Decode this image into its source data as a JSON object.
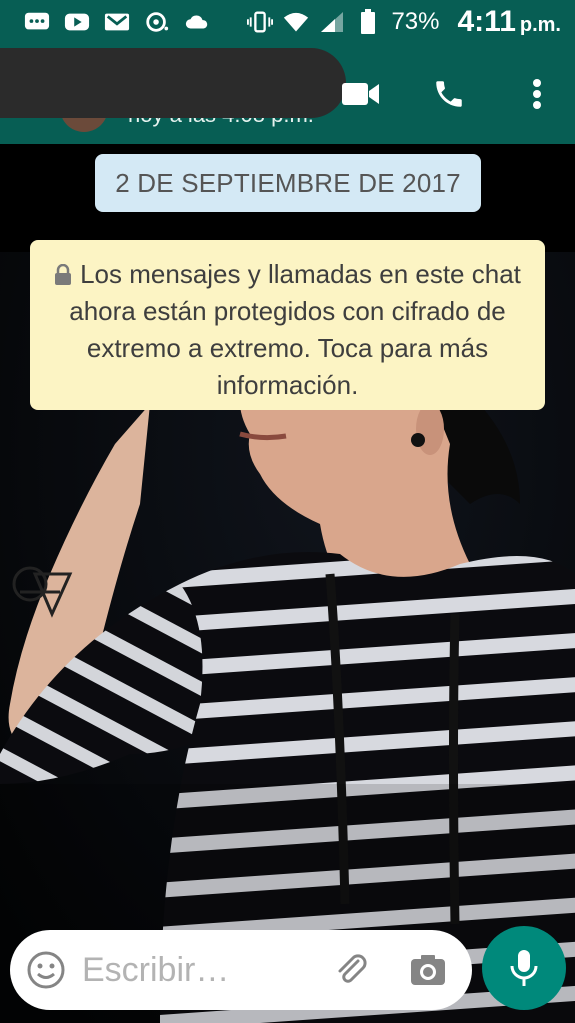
{
  "status_bar": {
    "battery_percent": "73%",
    "time": "4:11",
    "time_suffix": "p.m.",
    "icons": [
      "messages-icon",
      "youtube-icon",
      "gmail-icon",
      "chat-bubble-icon",
      "cloud-icon",
      "vibrate-icon",
      "wifi-icon",
      "signal-icon",
      "battery-icon"
    ]
  },
  "app_bar": {
    "last_seen": "hoy a las 4:08 p.m.",
    "actions": [
      "video-call-icon",
      "voice-call-icon",
      "more-options-icon"
    ]
  },
  "chat": {
    "date_chip": "2 DE SEPTIEMBRE DE 2017",
    "encryption_notice": "Los mensajes y llamadas en este chat ahora están protegidos con cifrado de extremo a extremo. Toca para más información."
  },
  "input": {
    "placeholder": "Escribir…",
    "icons": [
      "emoji-icon",
      "attach-icon",
      "camera-icon",
      "mic-icon"
    ]
  },
  "colors": {
    "header": "#075e54",
    "accent": "#00897b",
    "date_chip": "#d4e9f5",
    "notice": "#fcf4c4"
  }
}
